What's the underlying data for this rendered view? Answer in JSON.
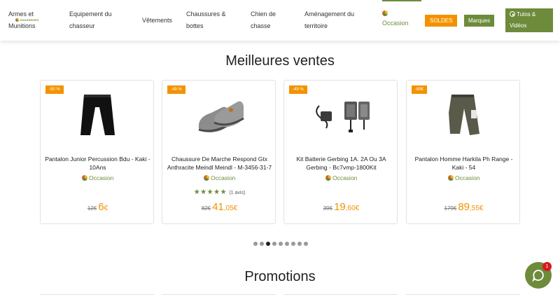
{
  "nav": {
    "logo_text": "CHASSEURS",
    "items": [
      {
        "line1": "Armes et",
        "line2": "Munitions"
      },
      {
        "line1": "Equipement du",
        "line2": "chasseur"
      },
      {
        "line1": "Vêtements",
        "line2": ""
      },
      {
        "line1": "Chaussures &",
        "line2": "bottes"
      },
      {
        "line1": "Chien de",
        "line2": "chasse"
      },
      {
        "line1": "Aménagement du",
        "line2": "territoire"
      }
    ],
    "occasion": "Occasion",
    "soldes": "SOLDES",
    "marques": "Marques",
    "tutos_line1": "Tutos &",
    "tutos_line2": "Vidéos"
  },
  "best_sellers": {
    "title": "Meilleures ventes",
    "products": [
      {
        "badge": "-50 %",
        "name_l1": "Pantalon Junior Percussion Bdu - Kaki -",
        "name_l2": "10Ans",
        "condition": "Occasion",
        "old_price": "12€",
        "price_int": "6",
        "price_dec": "€",
        "rating": "",
        "image": "black-pants"
      },
      {
        "badge": "-49 %",
        "name_l1": "Chaussure De Marche Respond Gtx",
        "name_l2": "Anthracite Meindl Meindl - M-3456-31-7",
        "condition": "Occasion",
        "stars": "★★★★★",
        "reviews": "(1 avis)",
        "old_price": "82€",
        "price_int": "41",
        "price_dec": ",05€",
        "image": "grey-shoes"
      },
      {
        "badge": "-49 %",
        "name_l1": "Kit Batterie Gerbing 1A. 2A Ou 3A",
        "name_l2": "Gerbing - Bc7vmp-1800Kit",
        "condition": "Occasion",
        "old_price": "39€",
        "price_int": "19",
        "price_dec": ",60€",
        "image": "battery-kit"
      },
      {
        "badge": "-89€",
        "name_l1": "Pantalon Homme Harkila Ph Range -",
        "name_l2": "Kaki - 54",
        "condition": "Occasion",
        "old_price": "179€",
        "price_int": "89",
        "price_dec": ",55€",
        "image": "khaki-pants"
      }
    ]
  },
  "carousel": {
    "dots": 9,
    "active": 3
  },
  "promotions": {
    "title": "Promotions"
  },
  "chat": {
    "count": "1"
  },
  "colors": {
    "accent_green": "#6d8b3a",
    "orange": "#f39200",
    "badge_red": "#d71920"
  }
}
